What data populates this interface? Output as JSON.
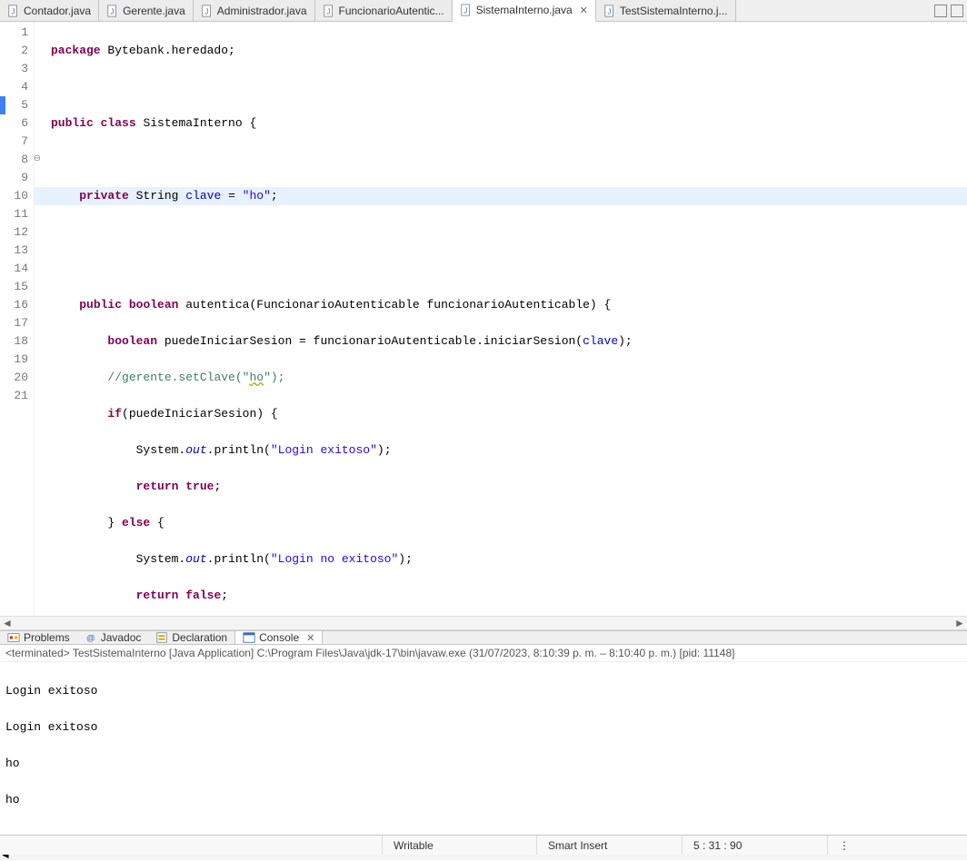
{
  "tabs": [
    {
      "label": "Contador.java",
      "active": false
    },
    {
      "label": "Gerente.java",
      "active": false
    },
    {
      "label": "Administrador.java",
      "active": false
    },
    {
      "label": "FuncionarioAutentic...",
      "active": false
    },
    {
      "label": "SistemaInterno.java",
      "active": true
    },
    {
      "label": "TestSistemaInterno.j...",
      "active": false
    }
  ],
  "code": {
    "l1": {
      "kw1": "package",
      "rest": " Bytebank.heredado;"
    },
    "l3": {
      "kw1": "public",
      "kw2": "class",
      "rest": " SistemaInterno {"
    },
    "l5": {
      "indent": "    ",
      "kw1": "private",
      "type": " String ",
      "field": "clave",
      "eq": " = ",
      "str": "\"ho\"",
      "semi": ";"
    },
    "l8": {
      "indent": "    ",
      "kw1": "public",
      "kw2": "boolean",
      "rest": " autentica(FuncionarioAutenticable funcionarioAutenticable) {"
    },
    "l9": {
      "indent": "        ",
      "kw1": "boolean",
      "var": " puedeIniciarSesion = funcionarioAutenticable.iniciarSesion(",
      "field": "clave",
      "close": ");"
    },
    "l10": {
      "indent": "        ",
      "cmt": "//gerente.setClave(\"",
      "warn": "ho",
      "cmt2": "\");"
    },
    "l11": {
      "indent": "        ",
      "kw1": "if",
      "rest": "(puedeIniciarSesion) {"
    },
    "l12": {
      "indent": "            ",
      "sys": "System.",
      "out": "out",
      "rest": ".println(",
      "str": "\"Login exitoso\"",
      "close": ");"
    },
    "l13": {
      "indent": "            ",
      "kw1": "return",
      "kw2": "true",
      "semi": ";"
    },
    "l14": {
      "indent": "        ",
      "brace": "} ",
      "kw1": "else",
      "rest": " {"
    },
    "l15": {
      "indent": "            ",
      "sys": "System.",
      "out": "out",
      "rest": ".println(",
      "str": "\"Login no exitoso\"",
      "close": ");"
    },
    "l16": {
      "indent": "            ",
      "kw1": "return",
      "kw2": "false",
      "semi": ";"
    },
    "l17": {
      "indent": "        ",
      "brace": "}"
    },
    "l19": {
      "indent": "    ",
      "brace": "}"
    },
    "l20": {
      "brace": "}"
    }
  },
  "lineNumbers": [
    "1",
    "2",
    "3",
    "4",
    "5",
    "6",
    "7",
    "8",
    "9",
    "10",
    "11",
    "12",
    "13",
    "14",
    "15",
    "16",
    "17",
    "18",
    "19",
    "20",
    "21"
  ],
  "bottomTabs": {
    "problems": "Problems",
    "javadoc": "Javadoc",
    "declaration": "Declaration",
    "console": "Console"
  },
  "consoleHeader": "<terminated> TestSistemaInterno [Java Application] C:\\Program Files\\Java\\jdk-17\\bin\\javaw.exe  (31/07/2023, 8:10:39 p. m. – 8:10:40 p. m.) [pid: 11148]",
  "consoleLines": [
    "Login exitoso",
    "Login exitoso",
    "ho",
    "ho"
  ],
  "status": {
    "writable": "Writable",
    "insert": "Smart Insert",
    "pos": "5 : 31 : 90"
  }
}
